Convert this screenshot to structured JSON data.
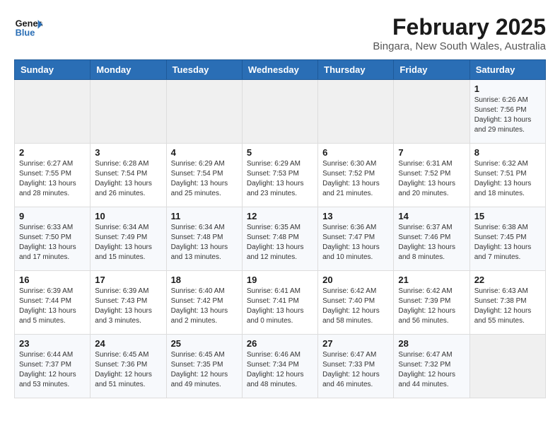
{
  "header": {
    "logo_line1": "General",
    "logo_line2": "Blue",
    "month_year": "February 2025",
    "location": "Bingara, New South Wales, Australia"
  },
  "weekdays": [
    "Sunday",
    "Monday",
    "Tuesday",
    "Wednesday",
    "Thursday",
    "Friday",
    "Saturday"
  ],
  "weeks": [
    [
      {
        "day": "",
        "info": ""
      },
      {
        "day": "",
        "info": ""
      },
      {
        "day": "",
        "info": ""
      },
      {
        "day": "",
        "info": ""
      },
      {
        "day": "",
        "info": ""
      },
      {
        "day": "",
        "info": ""
      },
      {
        "day": "1",
        "info": "Sunrise: 6:26 AM\nSunset: 7:56 PM\nDaylight: 13 hours and 29 minutes."
      }
    ],
    [
      {
        "day": "2",
        "info": "Sunrise: 6:27 AM\nSunset: 7:55 PM\nDaylight: 13 hours and 28 minutes."
      },
      {
        "day": "3",
        "info": "Sunrise: 6:28 AM\nSunset: 7:54 PM\nDaylight: 13 hours and 26 minutes."
      },
      {
        "day": "4",
        "info": "Sunrise: 6:29 AM\nSunset: 7:54 PM\nDaylight: 13 hours and 25 minutes."
      },
      {
        "day": "5",
        "info": "Sunrise: 6:29 AM\nSunset: 7:53 PM\nDaylight: 13 hours and 23 minutes."
      },
      {
        "day": "6",
        "info": "Sunrise: 6:30 AM\nSunset: 7:52 PM\nDaylight: 13 hours and 21 minutes."
      },
      {
        "day": "7",
        "info": "Sunrise: 6:31 AM\nSunset: 7:52 PM\nDaylight: 13 hours and 20 minutes."
      },
      {
        "day": "8",
        "info": "Sunrise: 6:32 AM\nSunset: 7:51 PM\nDaylight: 13 hours and 18 minutes."
      }
    ],
    [
      {
        "day": "9",
        "info": "Sunrise: 6:33 AM\nSunset: 7:50 PM\nDaylight: 13 hours and 17 minutes."
      },
      {
        "day": "10",
        "info": "Sunrise: 6:34 AM\nSunset: 7:49 PM\nDaylight: 13 hours and 15 minutes."
      },
      {
        "day": "11",
        "info": "Sunrise: 6:34 AM\nSunset: 7:48 PM\nDaylight: 13 hours and 13 minutes."
      },
      {
        "day": "12",
        "info": "Sunrise: 6:35 AM\nSunset: 7:48 PM\nDaylight: 13 hours and 12 minutes."
      },
      {
        "day": "13",
        "info": "Sunrise: 6:36 AM\nSunset: 7:47 PM\nDaylight: 13 hours and 10 minutes."
      },
      {
        "day": "14",
        "info": "Sunrise: 6:37 AM\nSunset: 7:46 PM\nDaylight: 13 hours and 8 minutes."
      },
      {
        "day": "15",
        "info": "Sunrise: 6:38 AM\nSunset: 7:45 PM\nDaylight: 13 hours and 7 minutes."
      }
    ],
    [
      {
        "day": "16",
        "info": "Sunrise: 6:39 AM\nSunset: 7:44 PM\nDaylight: 13 hours and 5 minutes."
      },
      {
        "day": "17",
        "info": "Sunrise: 6:39 AM\nSunset: 7:43 PM\nDaylight: 13 hours and 3 minutes."
      },
      {
        "day": "18",
        "info": "Sunrise: 6:40 AM\nSunset: 7:42 PM\nDaylight: 13 hours and 2 minutes."
      },
      {
        "day": "19",
        "info": "Sunrise: 6:41 AM\nSunset: 7:41 PM\nDaylight: 13 hours and 0 minutes."
      },
      {
        "day": "20",
        "info": "Sunrise: 6:42 AM\nSunset: 7:40 PM\nDaylight: 12 hours and 58 minutes."
      },
      {
        "day": "21",
        "info": "Sunrise: 6:42 AM\nSunset: 7:39 PM\nDaylight: 12 hours and 56 minutes."
      },
      {
        "day": "22",
        "info": "Sunrise: 6:43 AM\nSunset: 7:38 PM\nDaylight: 12 hours and 55 minutes."
      }
    ],
    [
      {
        "day": "23",
        "info": "Sunrise: 6:44 AM\nSunset: 7:37 PM\nDaylight: 12 hours and 53 minutes."
      },
      {
        "day": "24",
        "info": "Sunrise: 6:45 AM\nSunset: 7:36 PM\nDaylight: 12 hours and 51 minutes."
      },
      {
        "day": "25",
        "info": "Sunrise: 6:45 AM\nSunset: 7:35 PM\nDaylight: 12 hours and 49 minutes."
      },
      {
        "day": "26",
        "info": "Sunrise: 6:46 AM\nSunset: 7:34 PM\nDaylight: 12 hours and 48 minutes."
      },
      {
        "day": "27",
        "info": "Sunrise: 6:47 AM\nSunset: 7:33 PM\nDaylight: 12 hours and 46 minutes."
      },
      {
        "day": "28",
        "info": "Sunrise: 6:47 AM\nSunset: 7:32 PM\nDaylight: 12 hours and 44 minutes."
      },
      {
        "day": "",
        "info": ""
      }
    ]
  ]
}
